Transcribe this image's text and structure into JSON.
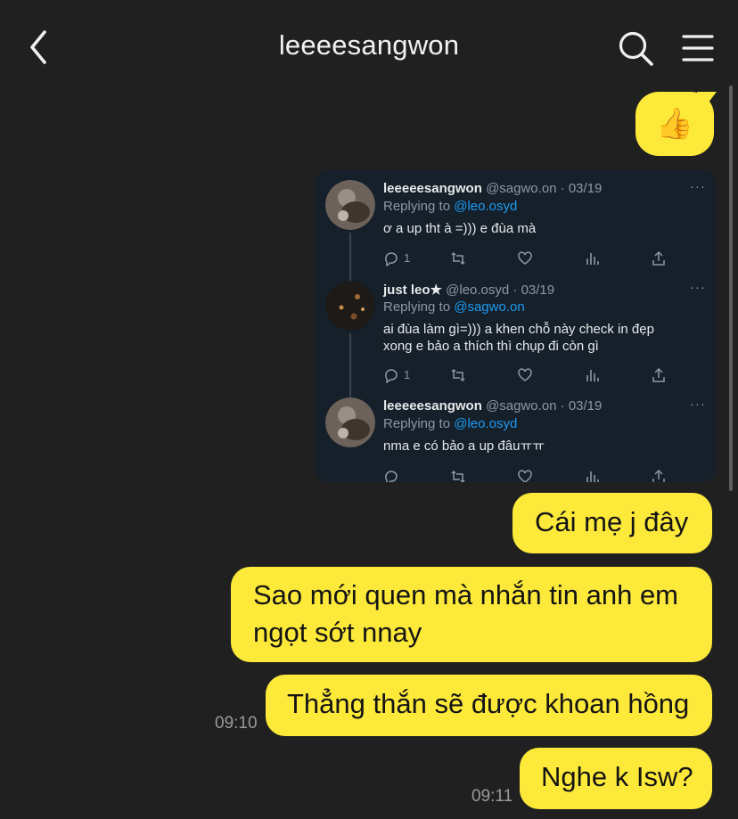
{
  "header": {
    "title": "leeeesangwon",
    "back_icon": "chevron-left-icon",
    "search_icon": "search-icon",
    "menu_icon": "hamburger-menu-icon"
  },
  "colors": {
    "background": "#202020",
    "bubble": "#fde93a",
    "tweet_bg": "#15202b",
    "link": "#1d9bf0"
  },
  "messages": {
    "thumb": "👍",
    "m1": "Cái mẹ j đây",
    "m2_line1": "Sao mới quen mà nhắn tin anh em",
    "m2_line2": "ngọt sớt nnay",
    "m3": "Thẳng thắn sẽ được khoan hồng",
    "m4": "Nghe k Isw?",
    "time1": "09:10",
    "time2": "09:11"
  },
  "tweets": [
    {
      "name": "leeeeesangwon",
      "meta": "@sagwo.on · 03/19",
      "replying_prefix": "Replying to ",
      "replying_to": "@leo.osyd",
      "text_lines": [
        "ơ a up tht à =))) e đùa mà"
      ],
      "reply_count": "1",
      "more": "···"
    },
    {
      "name": "just leo★",
      "meta": "@leo.osyd · 03/19",
      "replying_prefix": "Replying to ",
      "replying_to": "@sagwo.on",
      "text_lines": [
        "ai đùa làm gì=))) a khen chỗ này check in đẹp",
        "xong e bảo a thích thì chụp đi còn gì"
      ],
      "reply_count": "1",
      "more": "···"
    },
    {
      "name": "leeeeesangwon",
      "meta": "@sagwo.on · 03/19",
      "replying_prefix": "Replying to ",
      "replying_to": "@leo.osyd",
      "text_lines": [
        "nma e có bảo a up đâuㅠㅠ"
      ],
      "reply_count": "",
      "more": "···"
    }
  ]
}
